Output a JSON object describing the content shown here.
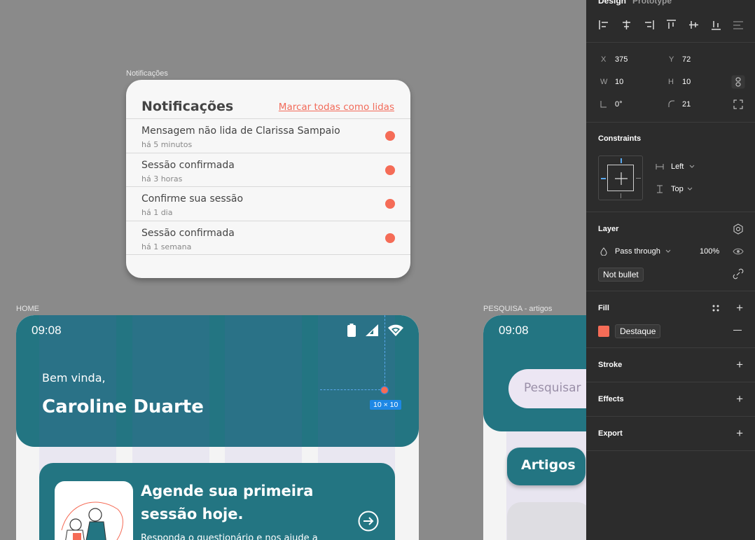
{
  "canvas": {
    "notif_frame_label": "Notificações",
    "home_frame_label": "HOME",
    "pesquisa_frame_label": "PESQUISA - artigos"
  },
  "notifications": {
    "title": "Notificações",
    "mark_all": "Marcar todas como lidas",
    "items": [
      {
        "message": "Mensagem não lida de Clarissa Sampaio",
        "time": "há 5 minutos"
      },
      {
        "message": "Sessão confirmada",
        "time": "há 3 horas"
      },
      {
        "message": "Confirme sua sessão",
        "time": "há 1 dia"
      },
      {
        "message": "Sessão confirmada",
        "time": "há 1 semana"
      }
    ],
    "dot_color": "#f56c57"
  },
  "home": {
    "status_time": "09:08",
    "greeting": "Bem vinda,",
    "user_name": "Caroline Duarte",
    "cta_title": "Agende sua primeira sessão hoje.",
    "cta_subtitle": "Responda o questionário e nos ajude a",
    "header_color": "#237582"
  },
  "selection": {
    "size_badge": "10 × 10"
  },
  "pesquisa": {
    "status_time": "09:08",
    "search_placeholder": "Pesquisar",
    "tab_artigos": "Artigos"
  },
  "panel": {
    "tabs": {
      "design": "Design",
      "prototype": "Prototype"
    },
    "x_label": "X",
    "x_value": "375",
    "y_label": "Y",
    "y_value": "72",
    "w_label": "W",
    "w_value": "10",
    "h_label": "H",
    "h_value": "10",
    "rotation": "0°",
    "radius": "21",
    "constraints_title": "Constraints",
    "constraint_h": "Left",
    "constraint_v": "Top",
    "layer_title": "Layer",
    "blend_mode": "Pass through",
    "opacity": "100%",
    "layer_name": "Not bullet",
    "fill_title": "Fill",
    "fill_style": "Destaque",
    "fill_color": "#f56c57",
    "stroke_title": "Stroke",
    "effects_title": "Effects",
    "export_title": "Export"
  }
}
